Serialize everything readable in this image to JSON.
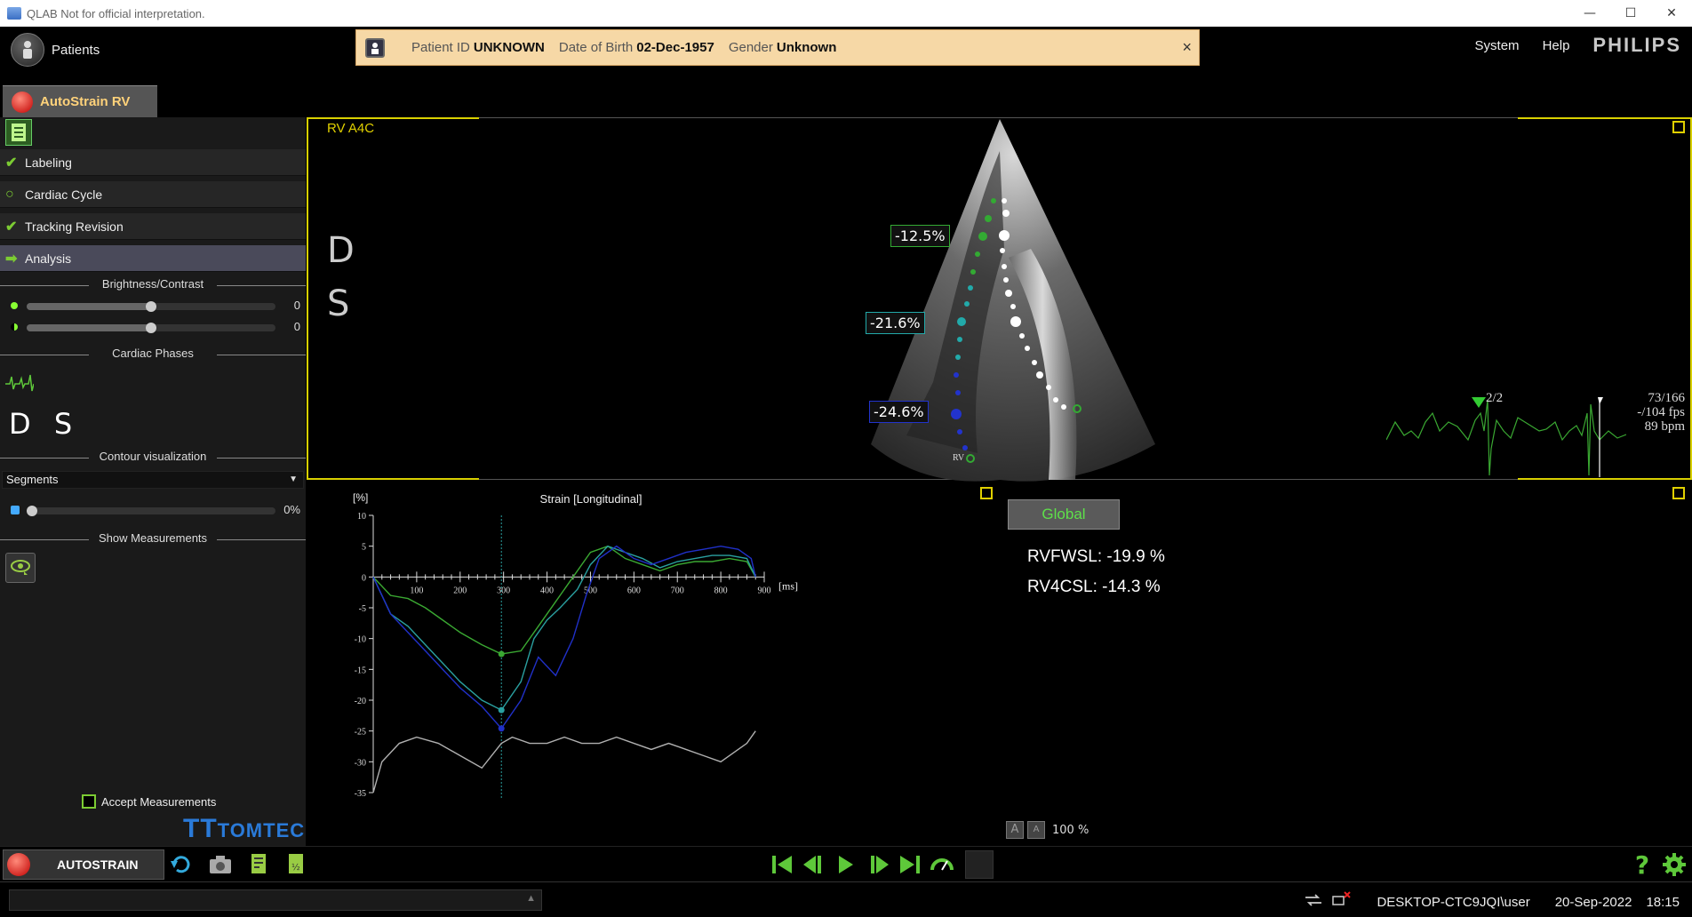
{
  "window": {
    "title": "QLAB Not for official interpretation.",
    "buttons": [
      "—",
      "☐",
      "✕"
    ]
  },
  "header": {
    "patients_label": "Patients",
    "patient": {
      "id_key": "Patient ID",
      "id_value": "UNKNOWN",
      "dob_key": "Date of Birth",
      "dob_value": "02-Dec-1957",
      "gender_key": "Gender",
      "gender_value": "Unknown",
      "close": "×"
    },
    "menu": {
      "system": "System",
      "help": "Help",
      "logo": "PHILIPS"
    },
    "tab_label": "AutoStrain RV"
  },
  "sidebar": {
    "steps": [
      {
        "label": "Labeling",
        "state": "done",
        "icon": "✔"
      },
      {
        "label": "Cardiac Cycle",
        "state": "pending",
        "icon": "○"
      },
      {
        "label": "Tracking Revision",
        "state": "done",
        "icon": "✔"
      },
      {
        "label": "Analysis",
        "state": "active",
        "icon": "➡"
      }
    ],
    "brightness_title": "Brightness/Contrast",
    "brightness_value": "0",
    "contrast_value": "0",
    "brightness_level": 0.5,
    "contrast_level": 0.5,
    "phases_title": "Cardiac Phases",
    "phases_text": "D S",
    "contour_title": "Contour visualization",
    "contour_select": "Segments",
    "contour_percent": "0%",
    "contour_level": 0.0,
    "measurements_title": "Show Measurements",
    "accept_label": "Accept Measurements",
    "vendor_logo": "TOMTEC"
  },
  "view": {
    "title": "RV A4C",
    "ds_d": "D",
    "ds_s": "S",
    "labels": [
      "-12.5%",
      "-21.6%",
      "-24.6%"
    ],
    "rv_label": "RV",
    "ecg": {
      "count": "2/2",
      "frames": "73/166",
      "fps": "-/104 fps",
      "bpm": "89 bpm"
    }
  },
  "chart_data": {
    "type": "line",
    "title": "Strain [Longitudinal]",
    "ylabel": "[%]",
    "xlabel": "[ms]",
    "xlim": [
      0,
      900
    ],
    "ylim": [
      -35,
      10
    ],
    "xticks": [
      100,
      200,
      300,
      400,
      500,
      600,
      700,
      800,
      900
    ],
    "yticks": [
      10,
      5,
      0,
      -5,
      -10,
      -15,
      -20,
      -25,
      -30,
      -35
    ],
    "marker_x": 295,
    "series": [
      {
        "color": "#3aa832",
        "x": [
          0,
          40,
          80,
          120,
          160,
          200,
          250,
          295,
          340,
          380,
          420,
          460,
          500,
          540,
          580,
          620,
          660,
          700,
          740,
          780,
          820,
          860,
          880
        ],
        "y": [
          0,
          -3,
          -3.5,
          -5,
          -7,
          -9,
          -11,
          -12.5,
          -12,
          -8,
          -4,
          0,
          4,
          5,
          3,
          2,
          1,
          2,
          2.5,
          2.5,
          3,
          2.5,
          0
        ]
      },
      {
        "color": "#2aa0a0",
        "x": [
          0,
          40,
          80,
          120,
          160,
          200,
          250,
          295,
          340,
          370,
          400,
          430,
          470,
          500,
          540,
          580,
          620,
          660,
          700,
          740,
          780,
          820,
          860,
          880
        ],
        "y": [
          0,
          -6,
          -8,
          -11,
          -14,
          -17,
          -20,
          -21.6,
          -17,
          -10,
          -7,
          -5,
          -2,
          2,
          5,
          4,
          3,
          1.5,
          2.5,
          3,
          3.5,
          3.5,
          3,
          0
        ]
      },
      {
        "color": "#2030c8",
        "x": [
          0,
          40,
          80,
          120,
          160,
          200,
          250,
          295,
          340,
          380,
          420,
          460,
          490,
          520,
          560,
          600,
          640,
          680,
          720,
          760,
          800,
          840,
          870,
          880
        ],
        "y": [
          0,
          -6,
          -9,
          -12,
          -15,
          -18,
          -21,
          -24.6,
          -20,
          -13,
          -16,
          -10,
          -3,
          3,
          5,
          3,
          2,
          3,
          4,
          4.5,
          5,
          4.5,
          3,
          0
        ]
      },
      {
        "color": "#b0b0b0",
        "x": [
          0,
          20,
          60,
          100,
          150,
          200,
          250,
          295,
          320,
          360,
          400,
          440,
          480,
          520,
          560,
          600,
          640,
          680,
          720,
          760,
          800,
          840,
          860,
          880
        ],
        "y": [
          -35,
          -30,
          -27,
          -26,
          -27,
          -29,
          -31,
          -27,
          -26,
          -27,
          -27,
          -26,
          -27,
          -27,
          -26,
          -27,
          -28,
          -27,
          -28,
          -29,
          -30,
          -28,
          -27,
          -25
        ]
      }
    ]
  },
  "results": {
    "global_label": "Global",
    "rvfwsl": "RVFWSL: -19.9 %",
    "rv4csl": "RV4CSL: -14.3 %",
    "zoom": "100 %",
    "zoom_a": "A"
  },
  "toolbar": {
    "autostrain_label": "AUTOSTRAIN"
  },
  "statusbar": {
    "user": "DESKTOP-CTC9JQI\\user",
    "date": "20-Sep-2022",
    "time": "18:15"
  },
  "colors": {
    "accent_yellow": "#e0d000",
    "accent_green": "#7ccc33",
    "patient_bar": "#f6d8a6"
  }
}
